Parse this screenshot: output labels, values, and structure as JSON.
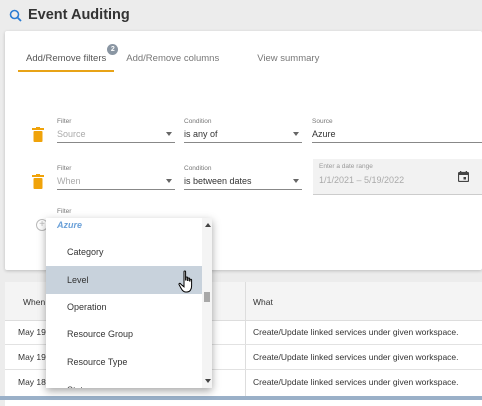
{
  "header": {
    "title": "Event Auditing",
    "icon": "search-icon"
  },
  "tabs": [
    {
      "label": "Add/Remove filters",
      "badge": "2",
      "active": true
    },
    {
      "label": "Add/Remove columns"
    },
    {
      "label": "View summary"
    }
  ],
  "filters": [
    {
      "filter_label": "Filter",
      "filter_value": "Source",
      "condition_label": "Condition",
      "condition_value": "is any of",
      "source_label": "Source",
      "source_value": "Azure"
    },
    {
      "filter_label": "Filter",
      "filter_value": "When",
      "condition_label": "Condition",
      "condition_value": "is between dates",
      "date_label": "Enter a date range",
      "date_value": "1/1/2021 – 5/19/2022"
    }
  ],
  "new_filter": {
    "label": "Filter"
  },
  "dropdown": {
    "selected": "Azure",
    "options": [
      "Category",
      "Level",
      "Operation",
      "Resource Group",
      "Resource Type",
      "Statu"
    ],
    "hovered": "Level"
  },
  "table": {
    "headers": [
      "When",
      "What"
    ],
    "rows": [
      {
        "when": "May 19",
        "what": "Create/Update linked services under given workspace."
      },
      {
        "when": "May 19",
        "what": "Create/Update linked services under given workspace."
      },
      {
        "when": "May 18",
        "what": "Create/Update linked services under given workspace."
      }
    ]
  },
  "colors": {
    "accent": "#e8a317",
    "trash": "#f0a30a",
    "link_blue": "#6aa0d8",
    "hover_row": "#c8d2dc"
  }
}
